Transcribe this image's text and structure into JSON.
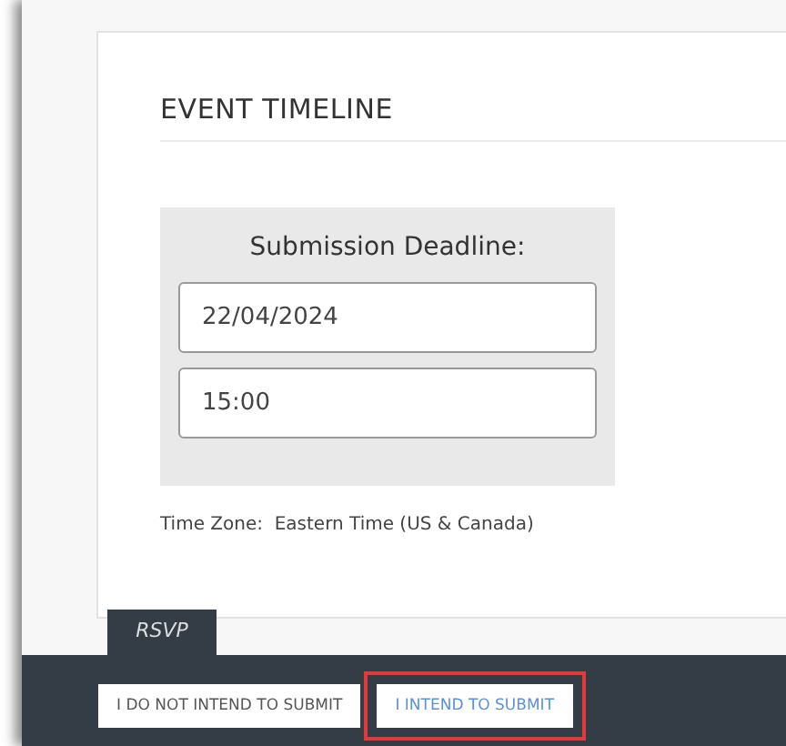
{
  "section": {
    "title": "EVENT TIMELINE"
  },
  "deadline": {
    "label": "Submission Deadline:",
    "date": "22/04/2024",
    "time": "15:00"
  },
  "time_zone": {
    "label": "Time Zone:",
    "value": "Eastern Time (US & Canada)"
  },
  "rsvp": {
    "tab": "RSVP",
    "buttons": [
      {
        "label": "I DO NOT INTEND TO SUBMIT",
        "selected": false
      },
      {
        "label": "I INTEND TO SUBMIT",
        "selected": true
      }
    ]
  }
}
